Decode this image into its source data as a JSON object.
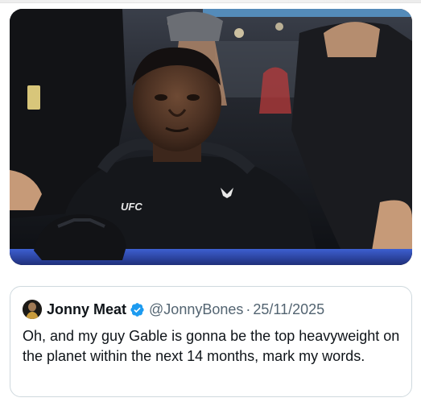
{
  "media": {
    "description_icon": "video-thumbnail"
  },
  "quote": {
    "author_name": "Jonny Meat",
    "author_handle": "@JonnyBones",
    "separator": "·",
    "date": "25/11/2025",
    "text": "Oh, and my guy Gable is gonna be the top heavyweight on the planet within the next 14 months, mark my words.",
    "verified_color": "#1d9bf0"
  }
}
